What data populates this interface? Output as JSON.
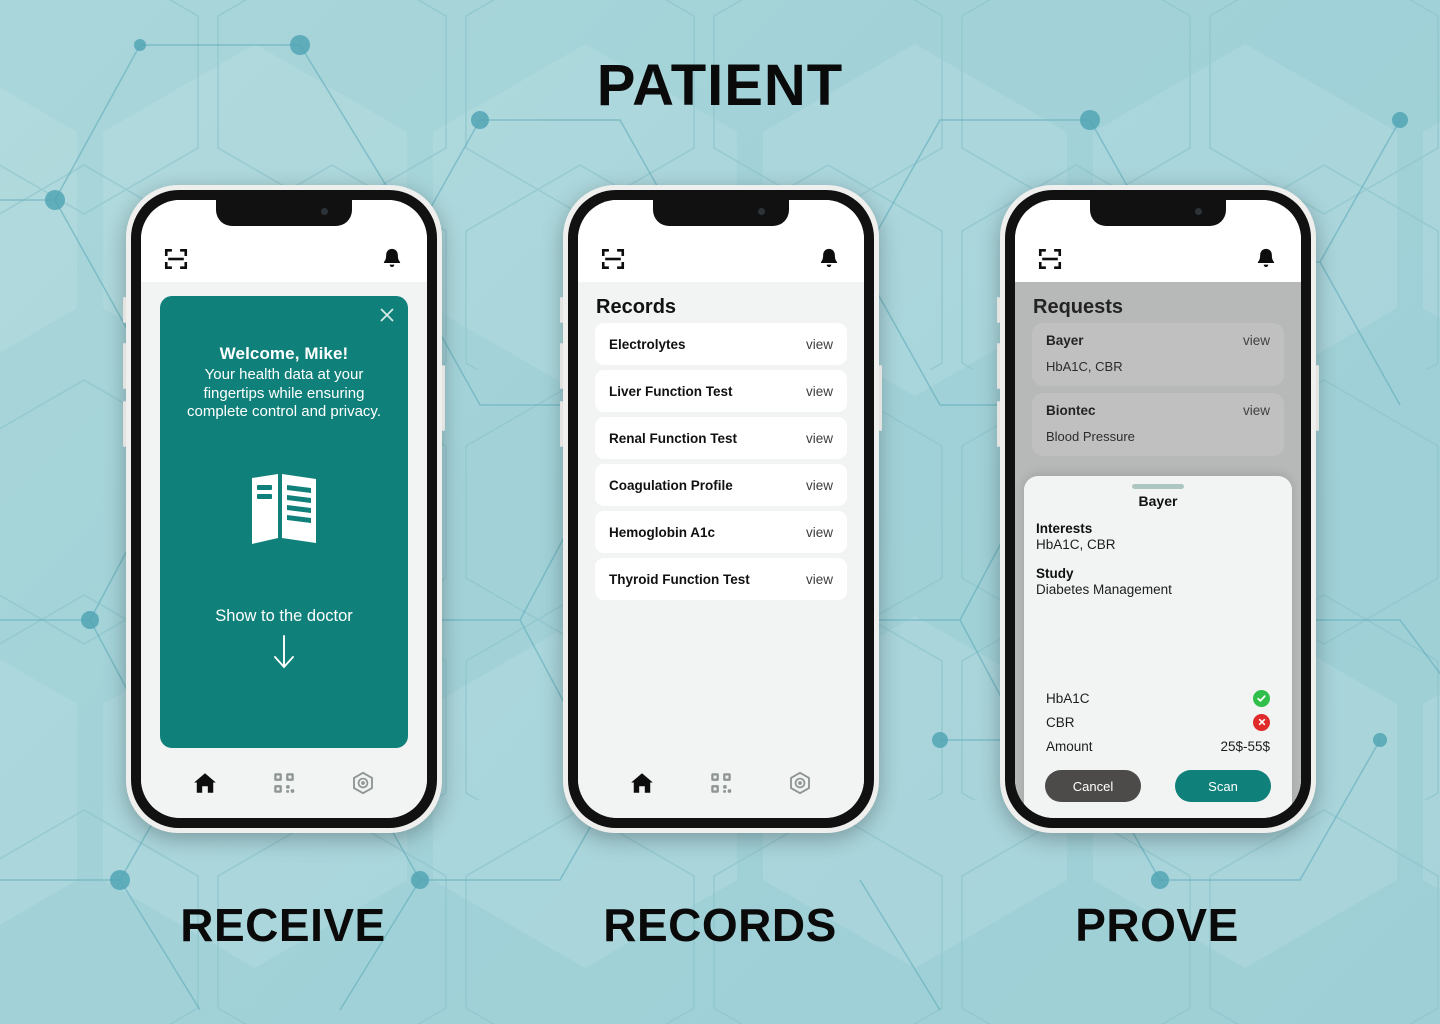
{
  "header": {
    "title": "PATIENT"
  },
  "colors": {
    "teal": "#10807a",
    "background": "#a3d2d8",
    "card": "#ffffff",
    "screen": "#f1f4f3",
    "success": "#2fbf4a",
    "danger": "#e02b2b",
    "cancel": "#4d4b4a"
  },
  "phones": [
    {
      "caption": "RECEIVE",
      "topbar": {
        "scan_icon": "scan-icon",
        "bell_icon": "bell-icon"
      },
      "welcome": {
        "close_icon": "close-icon",
        "title": "Welcome, Mike!",
        "subtitle": "Your health data at your fingertips while ensuring complete control and privacy.",
        "document_icon": "document-icon",
        "cta": "Show to the doctor",
        "arrow_icon": "arrow-down-icon"
      },
      "nav": [
        {
          "name": "home",
          "icon": "home-icon",
          "active": true
        },
        {
          "name": "qr",
          "icon": "qr-code-icon",
          "active": false
        },
        {
          "name": "settings",
          "icon": "hex-gear-icon",
          "active": false
        }
      ]
    },
    {
      "caption": "RECORDS",
      "topbar": {
        "scan_icon": "scan-icon",
        "bell_icon": "bell-icon"
      },
      "records": {
        "title": "Records",
        "action_label": "view",
        "items": [
          {
            "name": "Electrolytes",
            "action": "view"
          },
          {
            "name": "Liver Function Test",
            "action": "view"
          },
          {
            "name": "Renal Function Test",
            "action": "view"
          },
          {
            "name": "Coagulation Profile",
            "action": "view"
          },
          {
            "name": "Hemoglobin A1c",
            "action": "view"
          },
          {
            "name": "Thyroid Function Test",
            "action": "view"
          }
        ]
      },
      "nav": [
        {
          "name": "home",
          "icon": "home-icon",
          "active": true
        },
        {
          "name": "qr",
          "icon": "qr-code-icon",
          "active": false
        },
        {
          "name": "settings",
          "icon": "hex-gear-icon",
          "active": false
        }
      ]
    },
    {
      "caption": "PROVE",
      "topbar": {
        "scan_icon": "scan-icon",
        "bell_icon": "bell-icon"
      },
      "requests": {
        "title": "Requests",
        "items": [
          {
            "org": "Bayer",
            "action": "view",
            "items": "HbA1C, CBR"
          },
          {
            "org": "Biontec",
            "action": "view",
            "items": "Blood Pressure"
          }
        ]
      },
      "sheet": {
        "title": "Bayer",
        "interests_label": "Interests",
        "interests_value": "HbA1C, CBR",
        "study_label": "Study",
        "study_value": "Diabetes Management",
        "rows": [
          {
            "key": "HbA1C",
            "status": "ok",
            "value": ""
          },
          {
            "key": "CBR",
            "status": "no",
            "value": ""
          },
          {
            "key": "Amount",
            "status": "text",
            "value": "25$-55$"
          }
        ],
        "cancel_label": "Cancel",
        "scan_label": "Scan"
      }
    }
  ]
}
